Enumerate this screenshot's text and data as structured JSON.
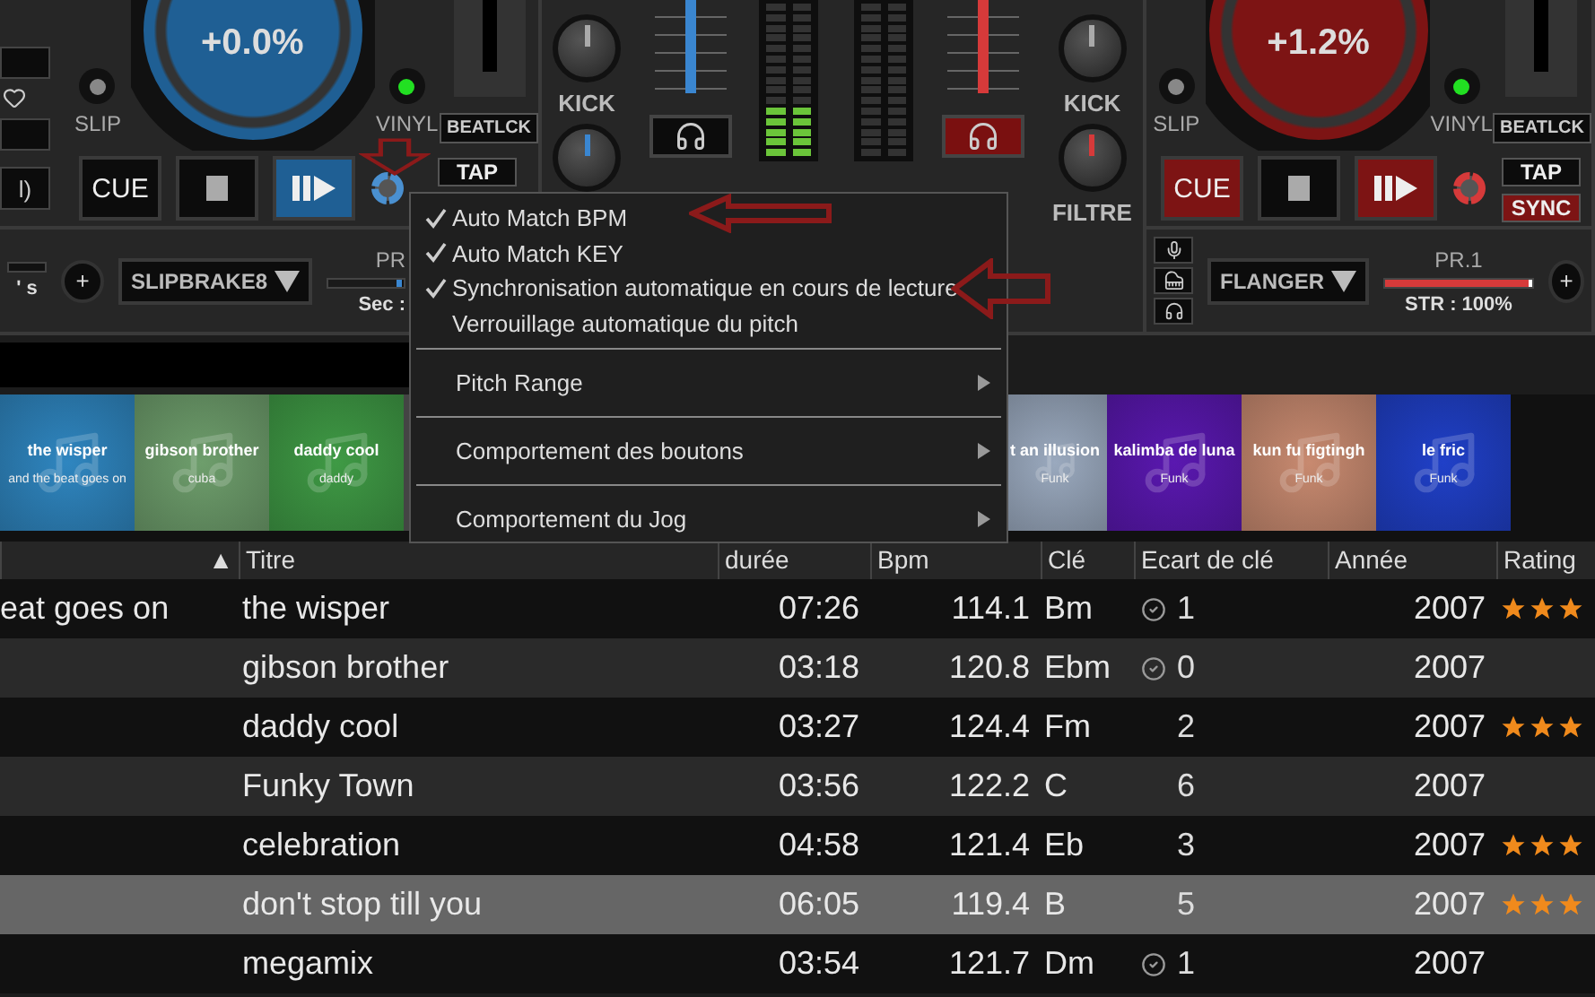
{
  "left_deck": {
    "color": "#1f5f94",
    "jog_reading": "+0.0%",
    "slip": {
      "label": "SLIP",
      "on": false
    },
    "vinyl": {
      "label": "VINYL",
      "on": true
    },
    "beatlock": "BEATLCK",
    "edge_text": "l)",
    "cue": {
      "label": "CUE",
      "lit": false
    },
    "tap": "TAP",
    "effect": "SLIPBRAKE8",
    "param_label": "PR",
    "param_slider": {
      "level": 0.97
    },
    "param_reading": "Sec :",
    "side_reading": "' s",
    "plus": "+"
  },
  "mixer": {
    "knob_labels": [
      "KICK",
      "KICK",
      "FILTRE"
    ],
    "headphones": [
      {
        "selected": false
      },
      {
        "selected": true
      }
    ],
    "meters": [
      {
        "level": 0.33
      },
      {
        "level": 0
      }
    ]
  },
  "right_deck": {
    "color": "#7d1414",
    "jog_reading": "+1.2%",
    "slip": {
      "label": "SLIP",
      "on": false
    },
    "vinyl": {
      "label": "VINYL",
      "on": true
    },
    "beatlock": "BEATLCK",
    "cue": {
      "label": "CUE",
      "lit": true
    },
    "tap": "TAP",
    "sync": "SYNC",
    "effect": "FLANGER",
    "param_label": "PR.1",
    "param_slider": {
      "level": 1
    },
    "param_reading": "STR :  100%",
    "plus": "+"
  },
  "menu": [
    {
      "label": "Auto Match BPM",
      "kind": "check",
      "checked": true
    },
    {
      "label": "Auto Match KEY",
      "kind": "check",
      "checked": true
    },
    {
      "label": "Synchronisation automatique en cours de lecture",
      "kind": "check",
      "checked": true
    },
    {
      "label": "Verrouillage automatique du pitch",
      "kind": "check",
      "checked": false
    },
    {
      "label": "Pitch Range",
      "kind": "submenu"
    },
    {
      "label": "Comportement des boutons",
      "kind": "submenu"
    },
    {
      "label": "Comportement du Jog",
      "kind": "submenu"
    }
  ],
  "thumbnails_left": [
    {
      "title": "the wisper",
      "subtitle": "and the beat goes on",
      "color": "#2f86c0"
    },
    {
      "title": "gibson brother",
      "subtitle": "cuba",
      "color": "#6e9e6c"
    },
    {
      "title": "daddy cool",
      "subtitle": "daddy",
      "color": "#3f9a45"
    }
  ],
  "thumbnails_right": [
    {
      "title": "t an illusion",
      "subtitle": "Funk",
      "color": "#9aa9be"
    },
    {
      "title": "kalimba de luna",
      "subtitle": "Funk",
      "color": "#5a18b0"
    },
    {
      "title": "kun fu figtingh",
      "subtitle": "Funk",
      "color": "#c88a70"
    },
    {
      "title": "le fric",
      "subtitle": "Funk",
      "color": "#2040c8"
    }
  ],
  "table": {
    "columns": [
      "▲",
      "Titre",
      "durée",
      "Bpm",
      "Clé",
      "Ecart de clé",
      "Année",
      "Rating"
    ],
    "rows": [
      {
        "column_1": "eat goes on",
        "title": "the wisper",
        "duration": "07:26",
        "bpm": "114.1",
        "key": "Bm",
        "key_match": true,
        "key_gap": "1",
        "year": "2007",
        "stars": 3,
        "selected": false
      },
      {
        "title": "gibson brother",
        "duration": "03:18",
        "bpm": "120.8",
        "key": "Ebm",
        "key_match": true,
        "key_gap": "0",
        "year": "2007",
        "selected": false
      },
      {
        "title": "daddy cool",
        "duration": "03:27",
        "bpm": "124.4",
        "key": "Fm",
        "key_match": false,
        "key_gap": "2",
        "year": "2007",
        "stars": 3,
        "selected": false
      },
      {
        "title": "Funky Town",
        "duration": "03:56",
        "bpm": "122.2",
        "key": "C",
        "key_match": false,
        "key_gap": "6",
        "year": "2007",
        "selected": false
      },
      {
        "title": "celebration",
        "duration": "04:58",
        "bpm": "121.4",
        "key": "Eb",
        "key_match": false,
        "key_gap": "3",
        "year": "2007",
        "stars": 3,
        "selected": false
      },
      {
        "title": "don't stop till you",
        "duration": "06:05",
        "bpm": "119.4",
        "key": "B",
        "key_match": false,
        "key_gap": "5",
        "year": "2007",
        "stars": 3,
        "selected": true
      },
      {
        "title": "megamix",
        "duration": "03:54",
        "bpm": "121.7",
        "key": "Dm",
        "key_match": true,
        "key_gap": "1",
        "year": "2007",
        "selected": false
      }
    ]
  }
}
